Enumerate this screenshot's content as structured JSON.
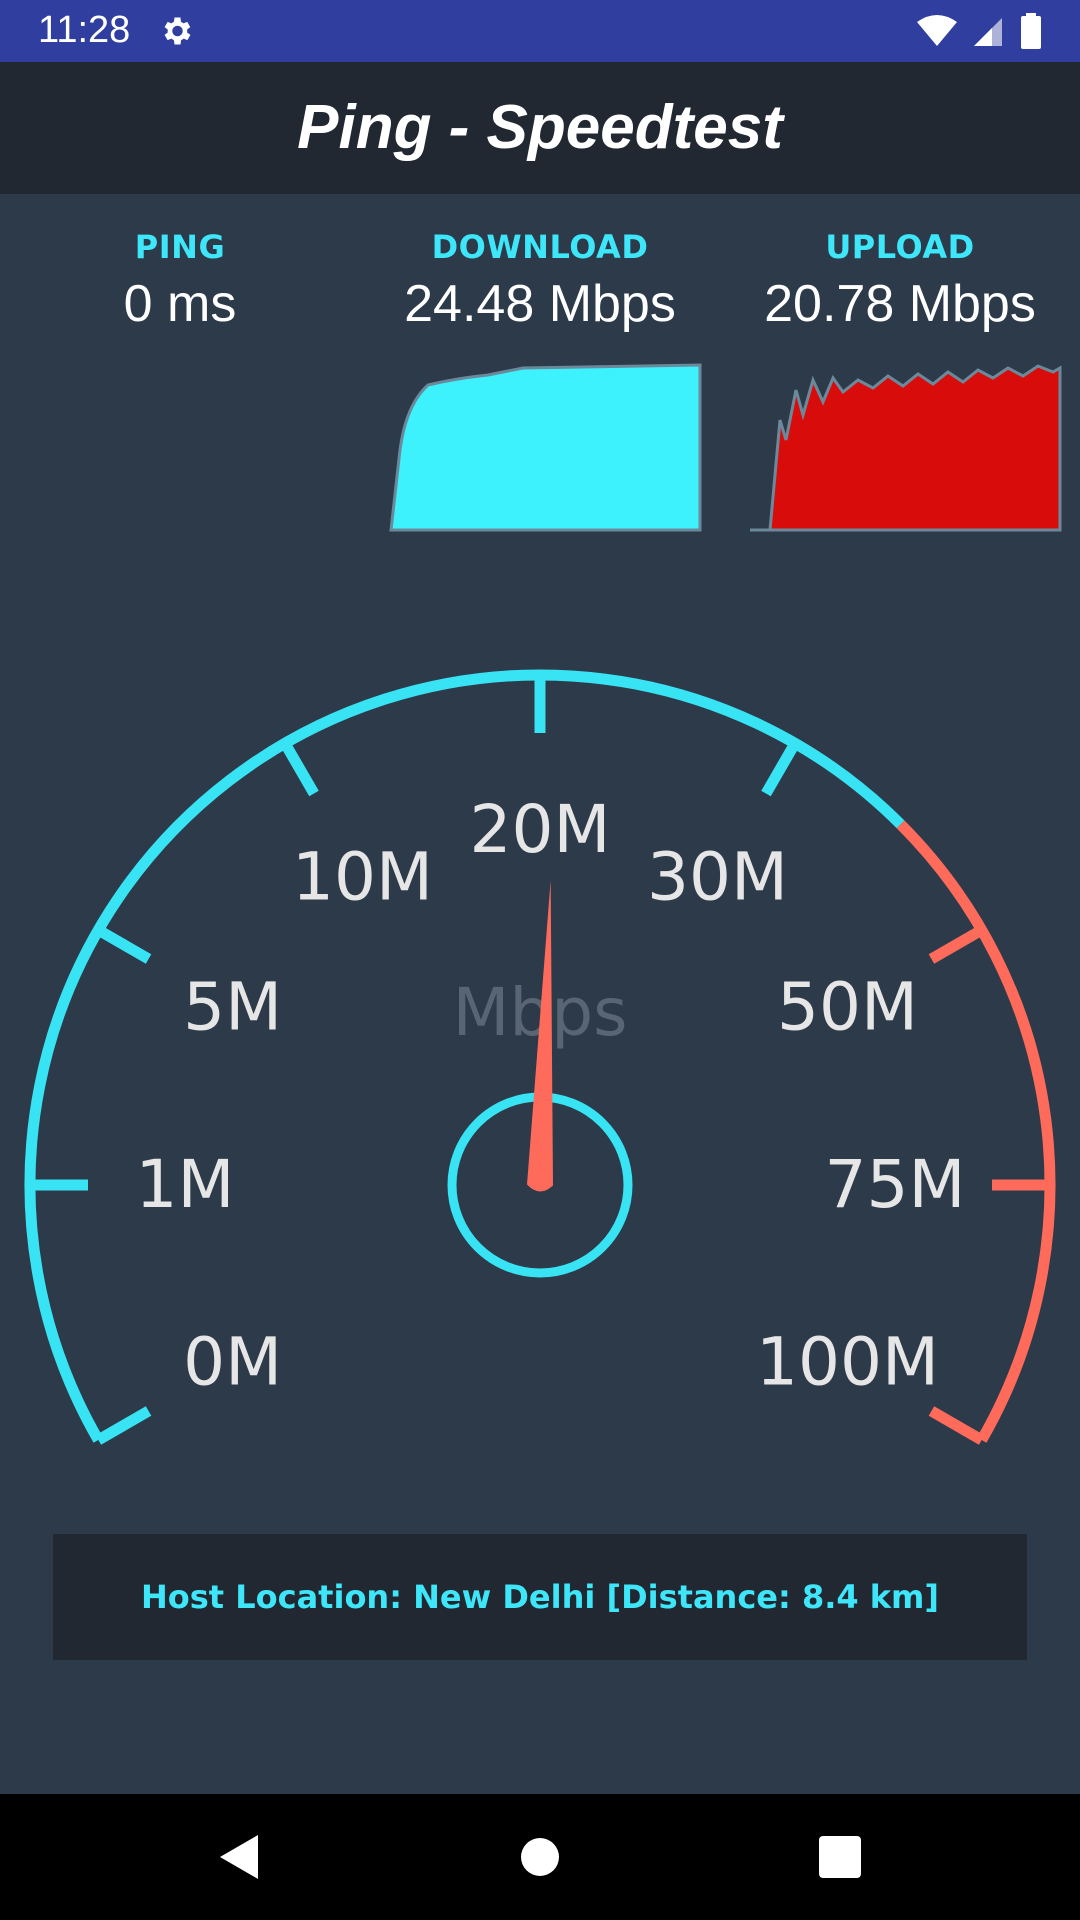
{
  "status_bar": {
    "time": "11:28",
    "icons": [
      "settings-icon",
      "wifi-icon",
      "cell-signal-icon",
      "battery-icon"
    ]
  },
  "toolbar": {
    "title": "Ping - Speedtest"
  },
  "metrics": {
    "ping": {
      "label": "PING",
      "value": "0 ms"
    },
    "download": {
      "label": "DOWNLOAD",
      "value": "24.48 Mbps",
      "color": "#3ef2fd"
    },
    "upload": {
      "label": "UPLOAD",
      "value": "20.78 Mbps",
      "color": "#d90c0c"
    }
  },
  "gauge": {
    "unit_label": "Mbps",
    "tick_labels": [
      "0M",
      "1M",
      "5M",
      "10M",
      "20M",
      "30M",
      "50M",
      "75M",
      "100M"
    ],
    "needle_position": "20M",
    "colors": {
      "normal": "#38e3f4",
      "high": "#ff6b5b",
      "needle": "#ff6b5b",
      "labels": "#e6e6e6",
      "unit": "#5a6573"
    }
  },
  "host": {
    "text": "Host Location: New Delhi [Distance: 8.4 km]"
  },
  "nav": {
    "icons": [
      "back-icon",
      "home-icon",
      "recents-icon"
    ]
  },
  "colors": {
    "status_bar": "#303f9f",
    "toolbar": "#222831",
    "background": "#2c3a4a",
    "accent": "#3ee6f9"
  }
}
